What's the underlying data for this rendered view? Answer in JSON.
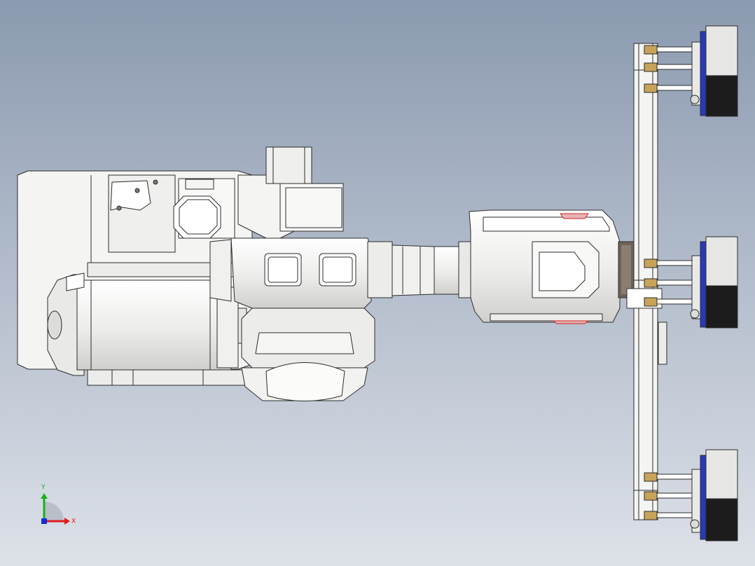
{
  "viewport": {
    "background_top": "#8b9ab0",
    "background_bottom": "#dde1e8"
  },
  "colors": {
    "body_fill": "#f4f4f2",
    "body_stroke": "#2b2b2b",
    "dark_block": "#1c1c1c",
    "blue_cap": "#2a39b8",
    "brass": "#c7a35a",
    "flange": "#6e6258",
    "accent_red": "#d02020"
  },
  "triad": {
    "x_label": "X",
    "y_label": "Y",
    "x_color": "#e01b1b",
    "y_color": "#19b019",
    "origin_color": "#1a2adb"
  }
}
